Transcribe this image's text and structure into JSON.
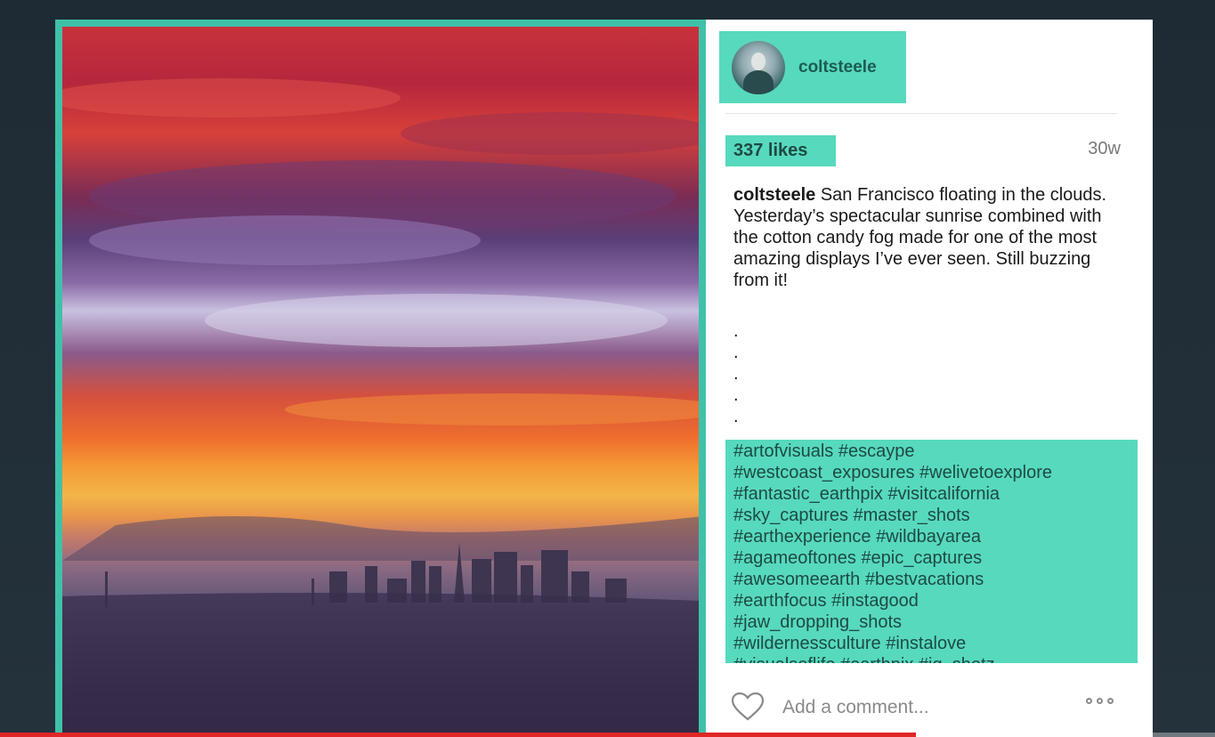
{
  "post": {
    "username": "coltsteele",
    "likes": "337 likes",
    "time": "30w",
    "caption_user": "coltsteele",
    "caption_text": " San Francisco floating in the clouds. Yesterday’s spectacular sunrise combined with the cotton candy fog made for one of the most amazing displays I’ve ever seen. Still buzzing from it!",
    "dots": [
      ".",
      ".",
      ".",
      ".",
      ".",
      "."
    ],
    "hashtags": [
      "#artofvisuals #escaype",
      "#westcoast_exposures #welivetoexplore",
      "#fantastic_earthpix #visitcalifornia",
      "#sky_captures #master_shots",
      "#earthexperience #wildbayarea",
      "#agameoftones #epic_captures",
      "#awesomeearth #bestvacations",
      "#earthfocus #instagood",
      "#jaw_dropping_shots",
      "#wildernessculture #instalove",
      "#visualsoflife #earthpix #ig_shotz"
    ]
  },
  "comment": {
    "placeholder": "Add a comment..."
  },
  "icons": {
    "like": "heart-icon",
    "more": "more-options-icon"
  },
  "video": {
    "progress": 0.754
  },
  "colors": {
    "highlight": "#57d9bd",
    "frame": "#3fc1a9",
    "progress": "#e02626"
  }
}
